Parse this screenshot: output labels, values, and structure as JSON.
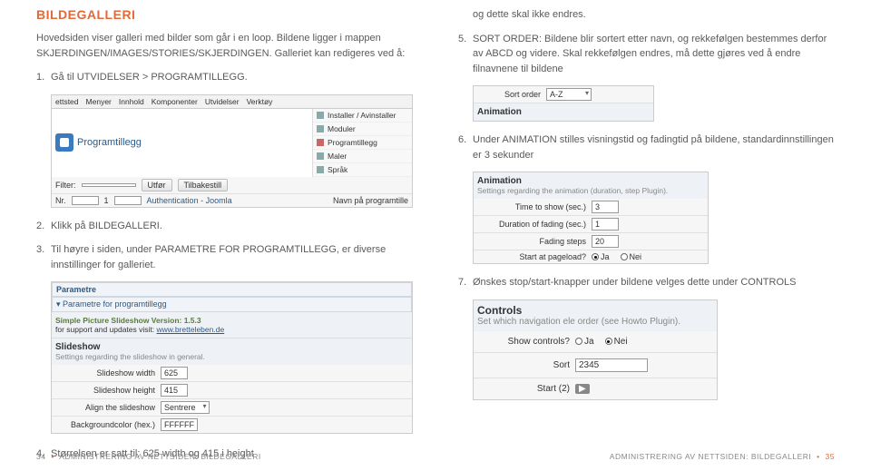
{
  "left": {
    "title": "BILDEGALLERI",
    "intro": "Hovedsiden viser galleri med bilder som går i en loop. Bildene ligger i mappen SKJERDINGEN/IMAGES/STORIES/SKJERDINGEN. Galleriet kan redigeres ved å:",
    "step1": {
      "num": "1.",
      "text": "Gå til UTVIDELSER > PROGRAMTILLEGG."
    },
    "menu": [
      "ettsted",
      "Menyer",
      "Innhold",
      "Komponenter",
      "Utvidelser",
      "Verktøy"
    ],
    "pluginLabel": "Programtillegg",
    "subItems": [
      "Installer / Avinstaller",
      "Moduler",
      "Programtillegg",
      "Maler",
      "Språk"
    ],
    "filterRow": {
      "label": "Filter:",
      "btn1": "Utfør",
      "btn2": "Tilbakestill"
    },
    "bottomRow": {
      "col1": "Nr.",
      "col2": "",
      "col3": "Authentication - Joomla",
      "right": "Navn på programtille"
    },
    "step2": {
      "num": "2.",
      "text": "Klikk på BILDEGALLERI."
    },
    "step3": {
      "num": "3.",
      "text": "Til høyre i siden, under PARAMETRE FOR PROGRAMTILLEGG, er diverse innstillinger for galleriet."
    },
    "params": {
      "title": "Parametre",
      "sub": "Parametre for programtillegg",
      "v1": "Simple Picture Slideshow Version: 1.5.3",
      "v2": "for support and updates visit: ",
      "link": "www.bretteleben.de",
      "slide": {
        "title": "Slideshow",
        "desc": "Settings regarding the slideshow in general."
      },
      "rows": {
        "width": {
          "lbl": "Slideshow width",
          "val": "625"
        },
        "height": {
          "lbl": "Slideshow height",
          "val": "415"
        },
        "align": {
          "lbl": "Align the slideshow",
          "val": "Sentrere"
        },
        "bg": {
          "lbl": "Backgroundcolor (hex.)",
          "val": "FFFFFF"
        }
      }
    },
    "step4": {
      "num": "4.",
      "text": "Størrelsen er satt til: 625 width og 415 i height"
    }
  },
  "right": {
    "continue": "og dette skal ikke endres.",
    "step5": {
      "num": "5.",
      "text": "SORT ORDER: Bildene blir sortert etter navn, og rekkefølgen bestemmes derfor av ABCD og videre. Skal rekkefølgen endres, må dette gjøres ved å endre filnavnene til bildene"
    },
    "sortShot": {
      "lbl": "Sort order",
      "val": "A-Z",
      "anim": "Animation"
    },
    "step6": {
      "num": "6.",
      "text": "Under ANIMATION stilles visningstid og fadingtid på bildene, standardinnstillingen er 3 sekunder"
    },
    "animShot": {
      "title": "Animation",
      "desc": "Settings regarding the animation (duration, step Plugin).",
      "r1": {
        "lbl": "Time to show (sec.)",
        "val": "3"
      },
      "r2": {
        "lbl": "Duration of fading (sec.)",
        "val": "1"
      },
      "r3": {
        "lbl": "Fading steps",
        "val": "20"
      },
      "r4": {
        "lbl": "Start at pageload?",
        "ja": "Ja",
        "nei": "Nei"
      }
    },
    "step7": {
      "num": "7.",
      "text": "Ønskes stop/start-knapper under bildene velges dette under CONTROLS"
    },
    "ctrlShot": {
      "title": "Controls",
      "desc": "Set which navigation ele order (see Howto Plugin).",
      "r1": {
        "lbl": "Show controls?",
        "ja": "Ja",
        "nei": "Nei"
      },
      "r2": {
        "lbl": "Sort",
        "val": "2345"
      },
      "r3": {
        "lbl": "Start (2)",
        "btn": "▶"
      }
    }
  },
  "footer": {
    "leftNum": "34",
    "leftText": "ADMINISTRERING AV NETTSIDEN: BILDEGALLERI",
    "rightText": "ADMINISTRERING AV NETTSIDEN: BILDEGALLERI",
    "rightNum": "35"
  }
}
